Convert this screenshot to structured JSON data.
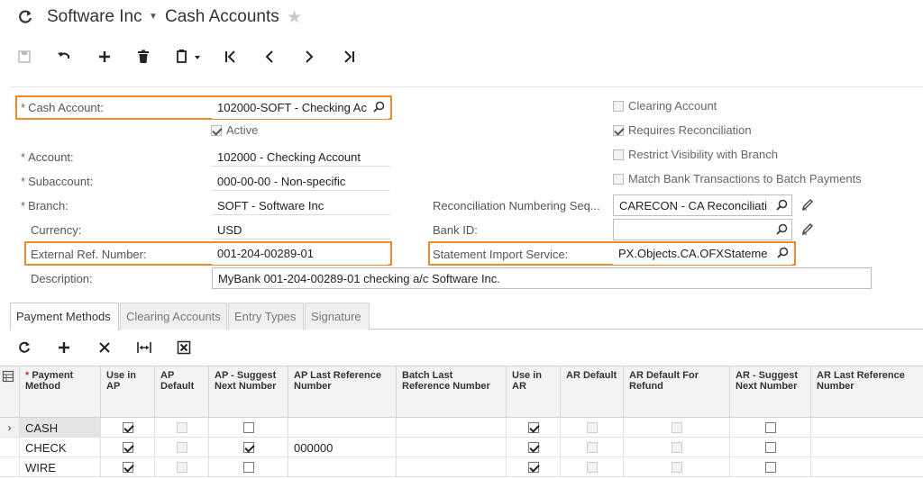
{
  "title": {
    "company": "Software Inc",
    "screen": "Cash Accounts"
  },
  "form": {
    "cash_account_label": "Cash Account:",
    "cash_account_value": "102000-SOFT - Checking Ac",
    "active_label": "Active",
    "account_label": "Account:",
    "account_value": "102000 - Checking Account",
    "subaccount_label": "Subaccount:",
    "subaccount_value": "000-00-00 - Non-specific",
    "branch_label": "Branch:",
    "branch_value": "SOFT - Software Inc",
    "currency_label": "Currency:",
    "currency_value": "USD",
    "external_ref_label": "External Ref. Number:",
    "external_ref_value": "001-204-00289-01",
    "description_label": "Description:",
    "description_value": "MyBank 001-204-00289-01 checking a/c Software Inc.",
    "clearing_account_label": "Clearing Account",
    "requires_reconciliation_label": "Requires Reconciliation",
    "restrict_visibility_label": "Restrict Visibility with Branch",
    "match_bank_label": "Match Bank Transactions to Batch Payments",
    "recon_seq_label": "Reconciliation Numbering Seq...",
    "recon_seq_value": "CARECON - CA Reconciliati",
    "bank_id_label": "Bank ID:",
    "bank_id_value": "",
    "statement_import_label": "Statement Import Service:",
    "statement_import_value": "PX.Objects.CA.OFXStateme",
    "required_mark": "*"
  },
  "tabs": [
    "Payment Methods",
    "Clearing Accounts",
    "Entry Types",
    "Signature"
  ],
  "grid": {
    "headers": [
      "Payment Method",
      "Use in AP",
      "AP Default",
      "AP - Suggest Next Number",
      "AP Last Reference Number",
      "Batch Last Reference Number",
      "Use in AR",
      "AR Default",
      "AR Default For Refund",
      "AR - Suggest Next Number",
      "AR Last Reference Number"
    ],
    "rows": [
      {
        "method": "CASH",
        "ap_last_ref": ""
      },
      {
        "method": "CHECK",
        "ap_last_ref": "000000"
      },
      {
        "method": "WIRE",
        "ap_last_ref": ""
      }
    ]
  },
  "colors": {
    "highlight": "#ef8a2b",
    "header_bg": "#f3f3f3"
  }
}
